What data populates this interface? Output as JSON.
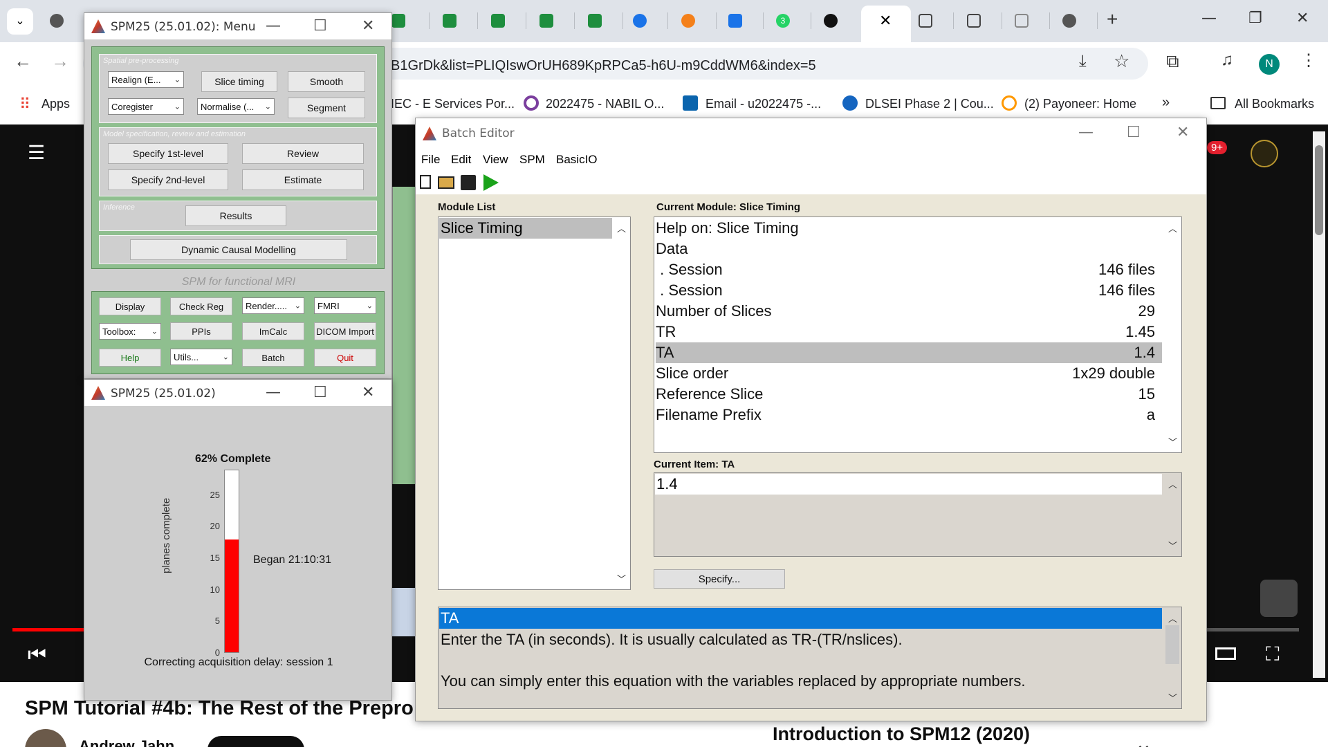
{
  "browser": {
    "url": "B1GrDk&list=PLIQIswOrUH689KpRPCa5-h6U-m9CddWM6&index=5",
    "tab_count_badge": "3",
    "profile_initial": "N",
    "notification_badge": "9+",
    "bookmarks": [
      {
        "label": "Apps"
      },
      {
        "label": "IEC - E Services Por..."
      },
      {
        "label": "2022475 - NABIL O..."
      },
      {
        "label": "Email - u2022475 -..."
      },
      {
        "label": "DLSEI Phase 2 | Cou..."
      },
      {
        "label": "(2) Payoneer: Home"
      },
      {
        "label": "All Bookmarks"
      }
    ],
    "bookmarks_overflow": "»"
  },
  "youtube": {
    "video_title": "SPM Tutorial #4b: The Rest of the Prepro",
    "channel": "Andrew Jahn",
    "next_video": "Introduction to SPM12 (2020)"
  },
  "spm_menu": {
    "title": "SPM25 (25.01.02): Menu",
    "sections": {
      "preprocessing_label": "Spatial pre-processing",
      "model_label": "Model specification, review and estimation",
      "inference_label": "Inference"
    },
    "dropdowns": {
      "realign": "Realign (E...",
      "coregister": "Coregister",
      "normalise": "Normalise (...",
      "render": "Render.....",
      "modality": "FMRI",
      "toolbox": "Toolbox:",
      "utils": "Utils..."
    },
    "buttons": {
      "slice_timing": "Slice timing",
      "smooth": "Smooth",
      "segment": "Segment",
      "specify_1st": "Specify 1st-level",
      "review": "Review",
      "specify_2nd": "Specify 2nd-level",
      "estimate": "Estimate",
      "results": "Results",
      "dcm": "Dynamic Causal Modelling",
      "display": "Display",
      "check_reg": "Check Reg",
      "ppis": "PPIs",
      "imcalc": "ImCalc",
      "dicom": "DICOM Import",
      "help": "Help",
      "batch": "Batch",
      "quit": "Quit"
    },
    "caption": "SPM for functional MRI"
  },
  "progress_window": {
    "title": "SPM25 (25.01.02)",
    "percent_label": "62% Complete",
    "ylabel": "planes complete",
    "ticks": [
      "0",
      "5",
      "10",
      "15",
      "20",
      "25"
    ],
    "began": "Began 21:10:31",
    "status": "Correcting acquisition delay: session 1",
    "progress_fraction": 0.62,
    "bar_color": "#ff0000"
  },
  "batch_editor": {
    "title": "Batch Editor",
    "menu": [
      "File",
      "Edit",
      "View",
      "SPM",
      "BasicIO"
    ],
    "module_list_label": "Module List",
    "modules": [
      "Slice Timing"
    ],
    "current_module_label": "Current Module: Slice Timing",
    "rows": [
      {
        "key": "Help on: Slice Timing",
        "val": ""
      },
      {
        "key": "Data",
        "val": ""
      },
      {
        "key": " . Session",
        "val": "146 files"
      },
      {
        "key": " . Session",
        "val": "146 files"
      },
      {
        "key": "Number of Slices",
        "val": "29"
      },
      {
        "key": "TR",
        "val": "1.45"
      },
      {
        "key": "TA",
        "val": "1.4",
        "selected": true
      },
      {
        "key": "Slice order",
        "val": "1x29 double"
      },
      {
        "key": "Reference Slice",
        "val": "15"
      },
      {
        "key": "Filename Prefix",
        "val": "a"
      }
    ],
    "current_item_label": "Current Item: TA",
    "current_item_value": "1.4",
    "specify_button": "Specify...",
    "help_title": "TA",
    "help_line1": "Enter the TA (in seconds). It is usually calculated as TR-(TR/nslices).",
    "help_line2": "You can simply enter this equation with the variables replaced by appropriate numbers."
  }
}
